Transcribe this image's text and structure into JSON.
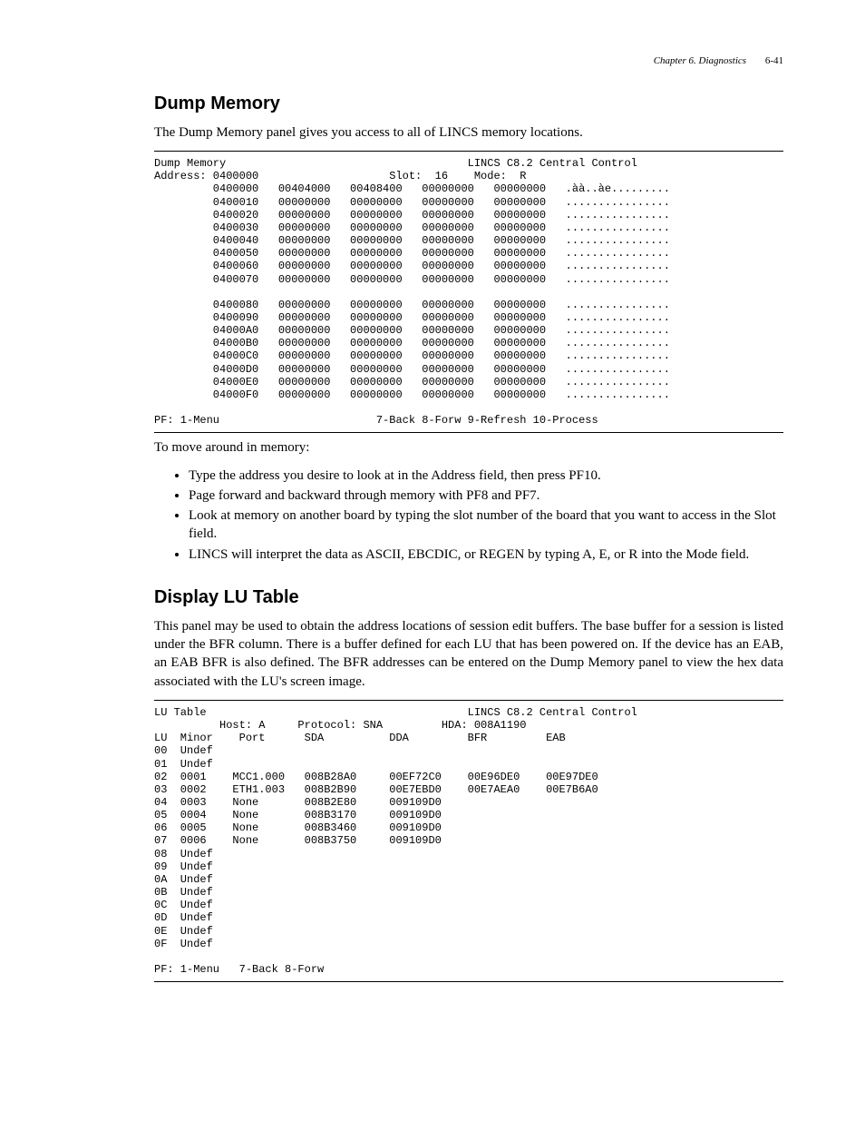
{
  "header": {
    "chapter": "Chapter 6. Diagnostics",
    "page": "6-41"
  },
  "s1": {
    "title": "Dump Memory",
    "intro": "The Dump Memory panel gives you access to all of LINCS memory locations.",
    "panel": "Dump Memory                                     LINCS C8.2 Central Control\nAddress: 0400000                    Slot:  16    Mode:  R\n         0400000   00404000   00408400   00000000   00000000   .àà..àe.........\n         0400010   00000000   00000000   00000000   00000000   ................\n         0400020   00000000   00000000   00000000   00000000   ................\n         0400030   00000000   00000000   00000000   00000000   ................\n         0400040   00000000   00000000   00000000   00000000   ................\n         0400050   00000000   00000000   00000000   00000000   ................\n         0400060   00000000   00000000   00000000   00000000   ................\n         0400070   00000000   00000000   00000000   00000000   ................\n\n         0400080   00000000   00000000   00000000   00000000   ................\n         0400090   00000000   00000000   00000000   00000000   ................\n         04000A0   00000000   00000000   00000000   00000000   ................\n         04000B0   00000000   00000000   00000000   00000000   ................\n         04000C0   00000000   00000000   00000000   00000000   ................\n         04000D0   00000000   00000000   00000000   00000000   ................\n         04000E0   00000000   00000000   00000000   00000000   ................\n         04000F0   00000000   00000000   00000000   00000000   ................\n\nPF: 1-Menu                        7-Back 8-Forw 9-Refresh 10-Process",
    "moveintro": "To move around in memory:",
    "bullets": [
      "Type the address you desire to look at in the Address field, then press PF10.",
      "Page forward and backward through memory with PF8 and PF7.",
      "Look at memory on another board by typing the slot number of the board that you want to access in the Slot field.",
      "LINCS will interpret the data as ASCII, EBCDIC, or REGEN by typing A, E, or R into the Mode field."
    ]
  },
  "s2": {
    "title": "Display LU Table",
    "intro": "This panel may be used to obtain the address locations of session edit buffers. The base buffer for a session is listed under the BFR column. There is a buffer defined for each LU that has been powered on. If the device has an EAB, an EAB BFR is also defined. The BFR addresses can be entered on the Dump Memory panel to view the hex data associated with the LU's screen image.",
    "panel": "LU Table                                        LINCS C8.2 Central Control\n          Host: A     Protocol: SNA         HDA: 008A1190\nLU  Minor    Port      SDA          DDA         BFR         EAB\n00  Undef\n01  Undef\n02  0001    MCC1.000   008B28A0     00EF72C0    00E96DE0    00E97DE0\n03  0002    ETH1.003   008B2B90     00E7EBD0    00E7AEA0    00E7B6A0\n04  0003    None       008B2E80     009109D0\n05  0004    None       008B3170     009109D0\n06  0005    None       008B3460     009109D0\n07  0006    None       008B3750     009109D0\n08  Undef\n09  Undef\n0A  Undef\n0B  Undef\n0C  Undef\n0D  Undef\n0E  Undef\n0F  Undef\n\nPF: 1-Menu   7-Back 8-Forw"
  }
}
